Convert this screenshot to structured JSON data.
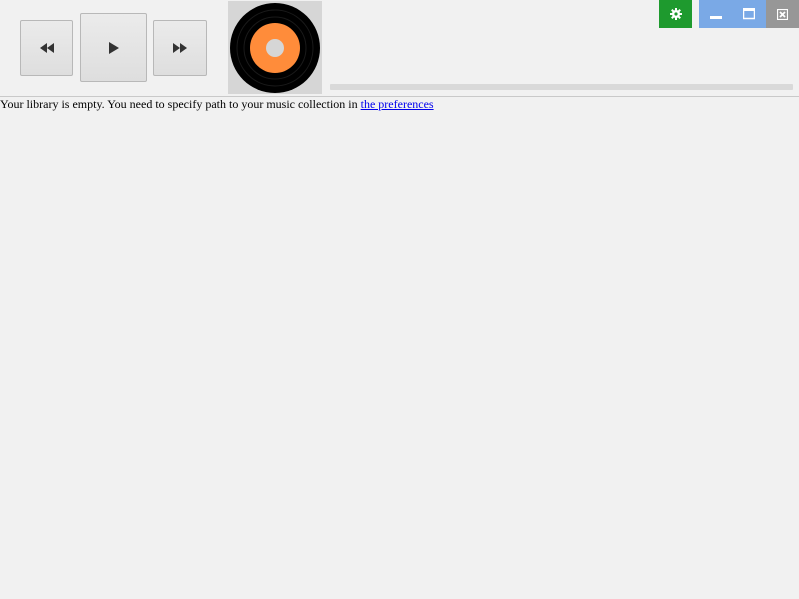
{
  "player": {
    "prev_icon": "rewind-icon",
    "play_icon": "play-icon",
    "next_icon": "fast-forward-icon",
    "cover_icon": "vinyl-record-icon",
    "progress_fraction": 0.0
  },
  "window_controls": {
    "settings_icon": "gear-icon",
    "minimize_icon": "minimize-icon",
    "maximize_icon": "maximize-icon",
    "close_icon": "close-icon",
    "colors": {
      "settings": "#1e9a2e",
      "min_max": "#7aa9e6",
      "close": "#979797"
    }
  },
  "library": {
    "empty_message": "Your library is empty. You need to specify path to your music collection in ",
    "preferences_link": "the preferences"
  },
  "colors": {
    "record_label": "#ff8c3a",
    "record_vinyl": "#000000",
    "link": "#0000ee"
  }
}
